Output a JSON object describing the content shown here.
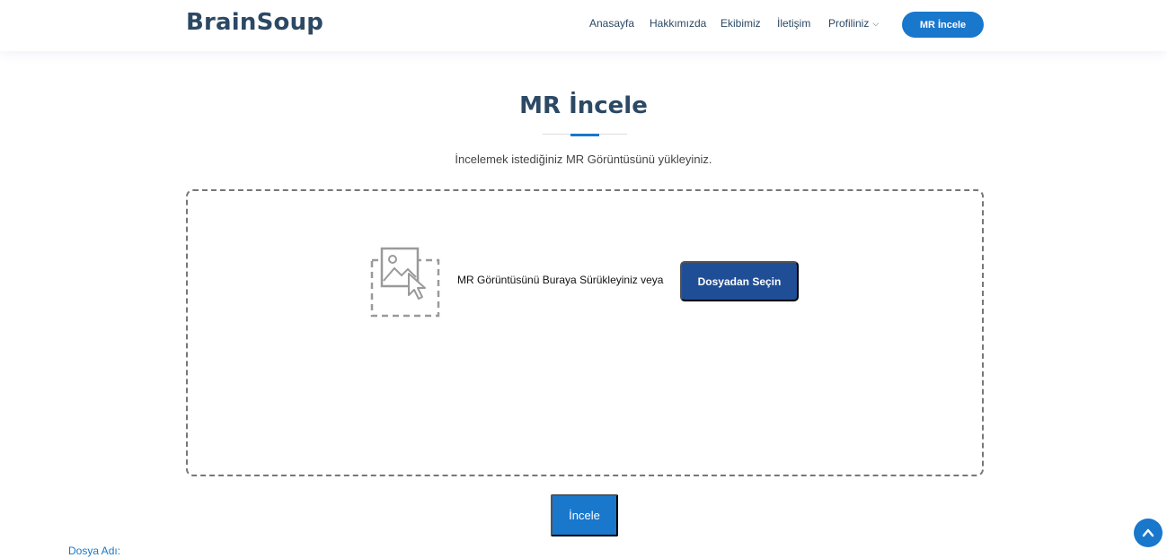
{
  "header": {
    "logo": "BrainSoup",
    "nav": [
      {
        "label": "Anasayfa"
      },
      {
        "label": "Hakkımızda"
      },
      {
        "label": "Ekibimiz"
      },
      {
        "label": "İletişim"
      },
      {
        "label": "Profiliniz"
      }
    ],
    "cta_label": "MR İncele"
  },
  "section": {
    "title": "MR İncele",
    "description": "İncelemek istediğiniz MR Görüntüsünü yükleyiniz."
  },
  "dropzone": {
    "icon": "image-upload-icon",
    "text": "MR Görüntüsünü Buraya Sürükleyiniz veya",
    "choose_label": "Dosyadan Seçin"
  },
  "analyze_label": "İncele",
  "file_name_label": "Dosya Adı:",
  "colors": {
    "primary": "#1977cc",
    "heading": "#2c4964",
    "choose_button": "#1f4e96"
  }
}
